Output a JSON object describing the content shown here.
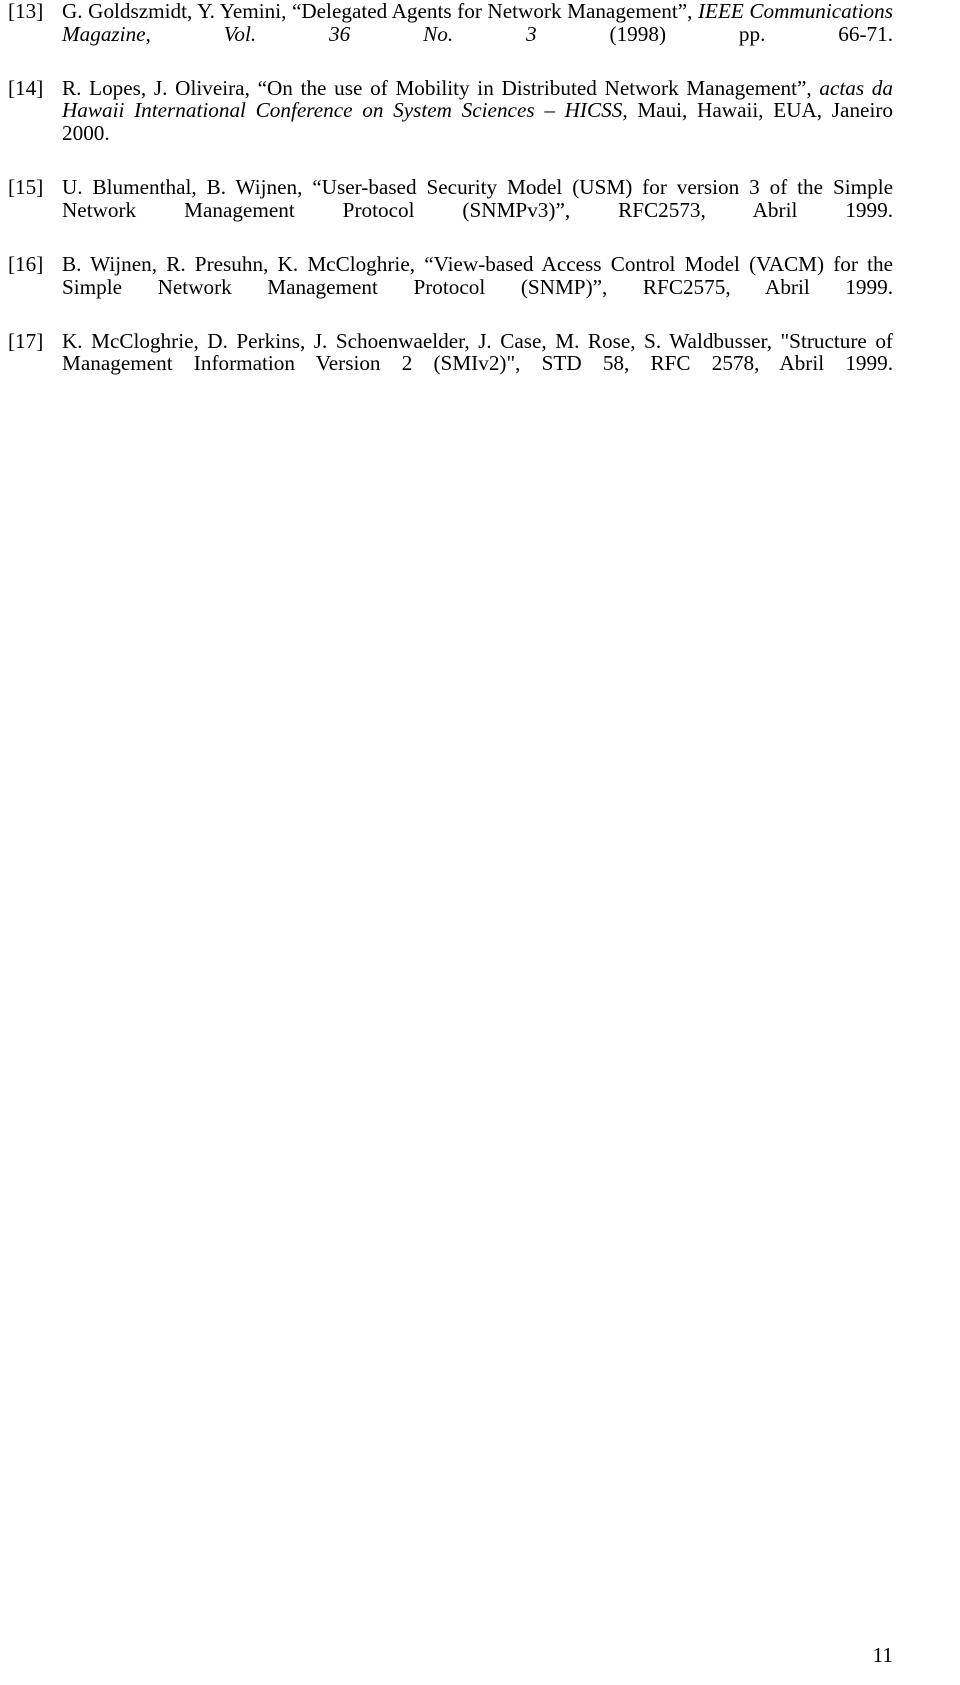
{
  "document": {
    "type": "references-page",
    "page_number": "11",
    "references": [
      {
        "label": "[13]",
        "segments": [
          {
            "text": "G. Goldszmidt, Y. Yemini, “Delegated Agents for Network Management”, ",
            "style": "normal"
          },
          {
            "text": "IEEE Communications Magazine, Vol. 36 No. 3",
            "style": "italic"
          },
          {
            "text": " (1998) pp. 66-71.",
            "style": "normal"
          }
        ],
        "plain": "G. Goldszmidt, Y. Yemini, “Delegated Agents for Network Management”, IEEE Communications Magazine, Vol. 36 No. 3 (1998) pp. 66-71."
      },
      {
        "label": "[14]",
        "segments": [
          {
            "text": "R. Lopes, J. Oliveira, “On the use of Mobility in Distributed Network Management”, ",
            "style": "normal"
          },
          {
            "text": "actas da Hawaii International Conference on System Sciences – HICSS",
            "style": "italic"
          },
          {
            "text": ", Maui, Hawaii, EUA, Janeiro 2000.",
            "style": "normal"
          }
        ],
        "plain": "R. Lopes, J. Oliveira, “On the use of Mobility in Distributed Network Management”, actas da Hawaii International Conference on System Sciences – HICSS, Maui, Hawaii, EUA, Janeiro 2000."
      },
      {
        "label": "[15]",
        "segments": [
          {
            "text": "U. Blumenthal, B. Wijnen, “User-based Security Model (USM) for version 3 of the Simple Network Management Protocol (SNMPv3)”, RFC2573, Abril 1999.",
            "style": "normal"
          }
        ],
        "plain": "U. Blumenthal, B. Wijnen, “User-based Security Model (USM) for version 3 of the Simple Network Management Protocol (SNMPv3)”, RFC2573, Abril 1999."
      },
      {
        "label": "[16]",
        "segments": [
          {
            "text": "B. Wijnen, R. Presuhn, K. McCloghrie, “View-based Access Control Model (VACM) for the Simple Network Management Protocol (SNMP)”, RFC2575, Abril 1999.",
            "style": "normal"
          }
        ],
        "plain": "B. Wijnen, R. Presuhn, K. McCloghrie, “View-based Access Control Model (VACM) for the Simple Network Management Protocol (SNMP)”, RFC2575, Abril 1999."
      },
      {
        "label": "[17]",
        "segments": [
          {
            "text": "K. McCloghrie, D. Perkins, J. Schoenwaelder, J. Case, M. Rose, S. Waldbusser, \"Structure of Management Information Version 2 (SMIv2)\", STD 58, RFC 2578, Abril 1999.",
            "style": "normal"
          }
        ],
        "plain": "K. McCloghrie, D. Perkins, J. Schoenwaelder, J. Case, M. Rose, S. Waldbusser, \"Structure of Management Information Version 2 (SMIv2)\", STD 58, RFC 2578, Abril 1999."
      }
    ]
  }
}
